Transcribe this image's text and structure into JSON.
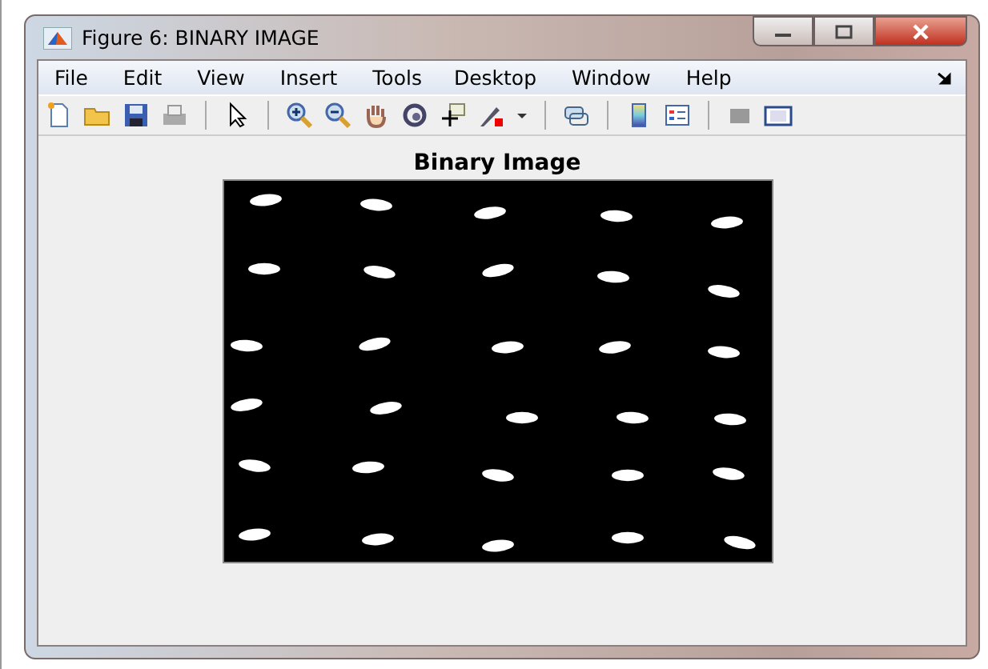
{
  "window": {
    "title": "Figure 6: BINARY IMAGE"
  },
  "menu": [
    "File",
    "Edit",
    "View",
    "Insert",
    "Tools",
    "Desktop",
    "Window",
    "Help"
  ],
  "toolbar": [
    {
      "kind": "new"
    },
    {
      "kind": "open"
    },
    {
      "kind": "save"
    },
    {
      "kind": "print"
    },
    {
      "kind": "sep"
    },
    {
      "kind": "pointer"
    },
    {
      "kind": "sep"
    },
    {
      "kind": "zoom-in"
    },
    {
      "kind": "zoom-out"
    },
    {
      "kind": "pan"
    },
    {
      "kind": "rotate"
    },
    {
      "kind": "cursor"
    },
    {
      "kind": "brush"
    },
    {
      "kind": "caret"
    },
    {
      "kind": "sep"
    },
    {
      "kind": "link"
    },
    {
      "kind": "sep"
    },
    {
      "kind": "colorbar"
    },
    {
      "kind": "legend"
    },
    {
      "kind": "sep"
    },
    {
      "kind": "hide"
    },
    {
      "kind": "show"
    }
  ],
  "axes": {
    "title": "Binary Image"
  }
}
